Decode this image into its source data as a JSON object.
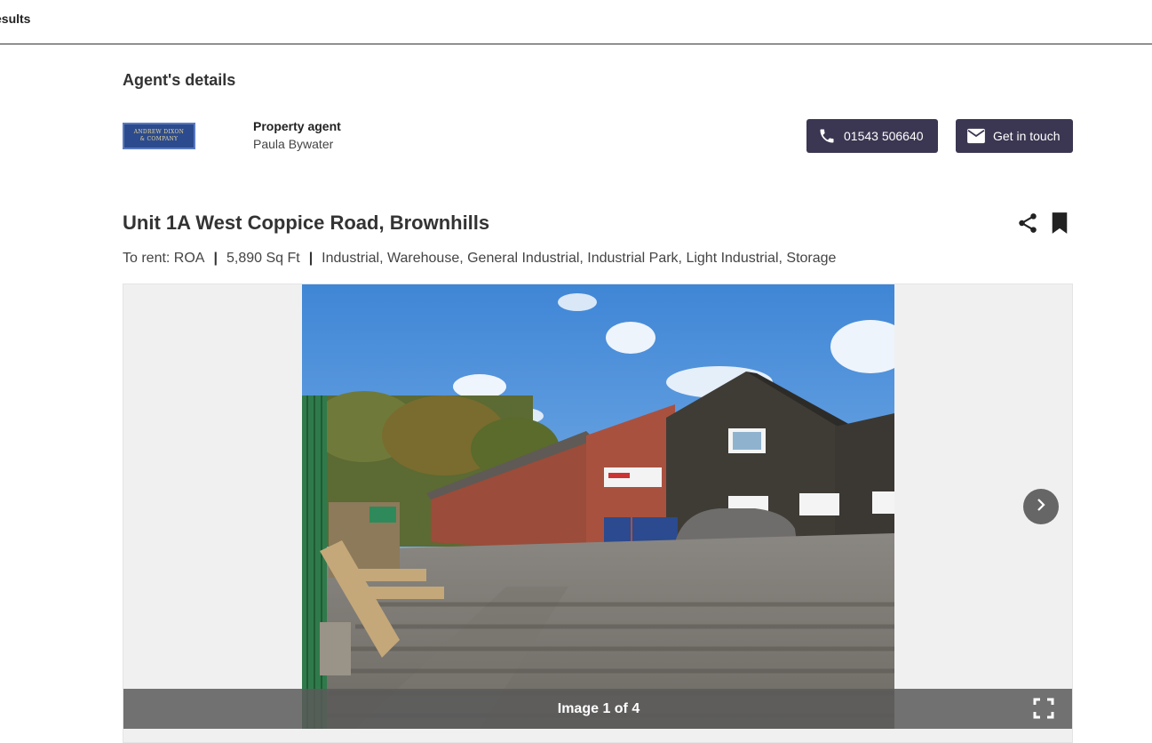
{
  "nav": {
    "back_label": "esults"
  },
  "agent": {
    "heading": "Agent's details",
    "logo_line1": "ANDREW DIXON",
    "logo_line2": "& COMPANY",
    "role": "Property agent",
    "name": "Paula Bywater",
    "phone_label": "01543 506640",
    "contact_label": "Get in touch"
  },
  "listing": {
    "title": "Unit 1A West Coppice Road, Brownhills",
    "price": "To rent: ROA",
    "size": "5,890 Sq Ft",
    "types": "Industrial, Warehouse, General Industrial, Industrial Park, Light Industrial, Storage",
    "separator": "|"
  },
  "gallery": {
    "caption": "Image 1 of 4",
    "current": 1,
    "total": 4
  },
  "icons": {
    "phone": "phone-icon",
    "mail": "mail-icon",
    "share": "share-icon",
    "bookmark": "bookmark-icon",
    "next": "chevron-right-icon",
    "fullscreen": "fullscreen-icon"
  },
  "colors": {
    "button_bg": "#3b3651",
    "logo_bg": "#2c4b8e",
    "caption_bg": "#5a5a5a"
  }
}
